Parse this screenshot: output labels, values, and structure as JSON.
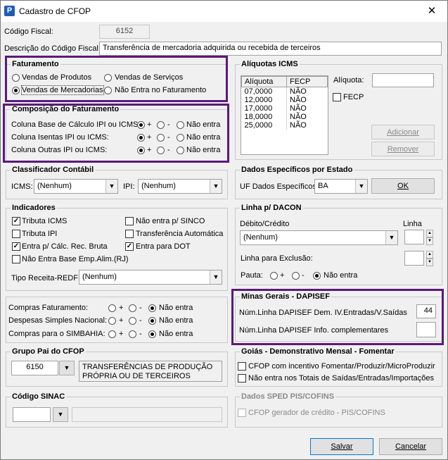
{
  "window": {
    "title": "Cadastro de CFOP",
    "app_icon": "P"
  },
  "codigo_fiscal": {
    "label": "Código Fiscal:",
    "value": "6152"
  },
  "descricao": {
    "label": "Descrição do Código Fiscal:",
    "value": "Transferência de mercadoria adquirida ou recebida de terceiros"
  },
  "faturamento": {
    "title": "Faturamento",
    "options": [
      "Vendas de Produtos",
      "Vendas de Serviços",
      "Vendas de Mercadorias",
      "Não Entra no Faturamento"
    ],
    "selected": "Vendas de Mercadorias"
  },
  "composicao": {
    "title": "Composição do Faturamento",
    "rows": [
      "Coluna Base de Cálculo IPI ou ICMS:",
      "Coluna Isentas IPI ou ICMS:",
      "Coluna Outras IPI ou ICMS:"
    ],
    "opt_plus": "+",
    "opt_minus": "-",
    "opt_none": "Não entra"
  },
  "aliquotas": {
    "title": "Alíquotas ICMS",
    "columns": [
      "Alíquota",
      "FECP"
    ],
    "rows": [
      [
        "07,0000",
        "NÃO"
      ],
      [
        "12,0000",
        "NÃO"
      ],
      [
        "17,0000",
        "NÃO"
      ],
      [
        "18,0000",
        "NÃO"
      ],
      [
        "25,0000",
        "NÃO"
      ]
    ],
    "aliquota_label": "Alíquota:",
    "fecp_label": "FECP",
    "add_button": "Adicionar",
    "remove_button": "Remover"
  },
  "classificador": {
    "title": "Classificador Contábil",
    "icms_label": "ICMS:",
    "icms_value": "(Nenhum)",
    "ipi_label": "IPI:",
    "ipi_value": "(Nenhum)"
  },
  "dados_estado": {
    "title": "Dados Específicos por Estado",
    "uf_label": "UF Dados Específicos:",
    "uf_value": "BA",
    "ok_button": "OK"
  },
  "indicadores": {
    "title": "Indicadores",
    "items": [
      {
        "label": "Tributa ICMS",
        "checked": true
      },
      {
        "label": "Não entra p/ SINCO",
        "checked": false
      },
      {
        "label": "Tributa IPI",
        "checked": false
      },
      {
        "label": "Transferência Automática",
        "checked": false
      },
      {
        "label": "Entra p/ Cálc. Rec. Bruta",
        "checked": true
      },
      {
        "label": "Entra para DOT",
        "checked": true
      },
      {
        "label": "Não Entra Base Emp.Alim.(RJ)",
        "checked": false
      }
    ],
    "tipo_receita_label": "Tipo Receita-REDF:",
    "tipo_receita_value": "(Nenhum)"
  },
  "dacon": {
    "title": "Linha p/ DACON",
    "debito_label": "Débito/Crédito",
    "debito_value": "(Nenhum)",
    "linha_label": "Linha",
    "exclusao_label": "Linha para Exclusão:",
    "pauta_label": "Pauta:",
    "opt_plus": "+",
    "opt_minus": "-",
    "opt_none": "Não entra"
  },
  "compras": {
    "rows": [
      "Compras Faturamento:",
      "Despesas Simples Nacional:",
      "Compras para o SIMBAHIA:"
    ],
    "opt_plus": "+",
    "opt_minus": "-",
    "opt_none": "Não entra"
  },
  "minas": {
    "title": "Minas Gerais - DAPISEF",
    "linha_dem_label": "Núm.Linha DAPISEF Dem. IV.Entradas/V.Saídas",
    "linha_dem_value": "44",
    "linha_info_label": "Núm.Linha DAPISEF Info. complementares",
    "linha_info_value": ""
  },
  "grupo_pai": {
    "title": "Grupo Pai do CFOP",
    "code": "6150",
    "description": "TRANSFERÊNCIAS DE PRODUÇÃO PRÓPRIA OU DE TERCEIROS"
  },
  "goias": {
    "title": "Goiás - Demonstrativo Mensal - Fomentar",
    "items": [
      "CFOP com incentivo  Fomentar/Produzir/MicroProduzir",
      "Não entra nos Totais de  Saídas/Entradas/Importações"
    ]
  },
  "sinac": {
    "title": "Código SINAC"
  },
  "sped": {
    "title": "Dados SPED PIS/COFINS",
    "item": "CFOP gerador de crédito - PIS/COFINS"
  },
  "buttons": {
    "salvar": "Salvar",
    "cancelar": "Cancelar"
  },
  "colors": {
    "highlight": "#5a1a7a",
    "icon_blue": "#1e5db4"
  }
}
